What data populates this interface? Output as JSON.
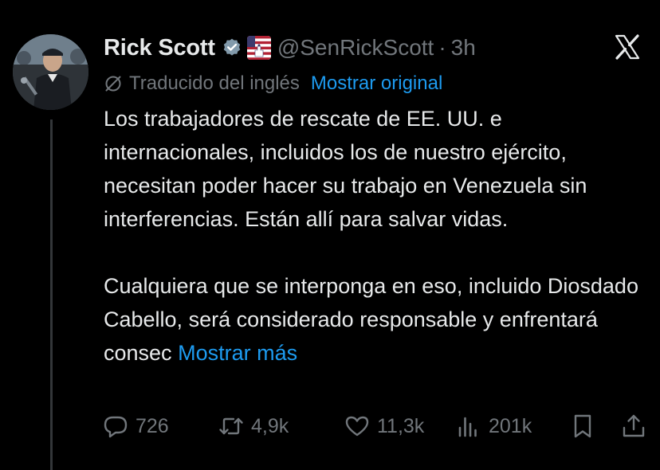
{
  "author": {
    "name": "Rick Scott",
    "handle": "@SenRickScott",
    "separator": "·",
    "time": "3h"
  },
  "translation": {
    "note": "Traducido del inglés",
    "show_original": "Mostrar original"
  },
  "body": {
    "paragraph1": "Los trabajadores de rescate de EE. UU. e internacionales, incluidos los de nuestro ejército, necesitan poder hacer su trabajo en Venezuela sin interferencias. Están allí para salvar vidas.",
    "paragraph2": "Cualquiera que se interponga en eso, incluido Diosdado Cabello, será considerado responsable y enfrentará consec",
    "show_more": "Mostrar más"
  },
  "actions": {
    "replies": "726",
    "reposts": "4,9k",
    "likes": "11,3k",
    "views": "201k"
  },
  "colors": {
    "background": "#000000",
    "text": "#e7e9ea",
    "muted": "#71767b",
    "accent": "#1d9bf0"
  },
  "icons": {
    "verified": "verified-badge-icon",
    "government": "us-flag-capitol-badge-icon",
    "platform": "x-logo-icon",
    "translate": "translate-slash-icon",
    "reply": "reply-bubble-icon",
    "repost": "repost-icon",
    "like": "heart-icon",
    "views": "views-bars-icon",
    "bookmark": "bookmark-icon",
    "share": "share-icon"
  }
}
